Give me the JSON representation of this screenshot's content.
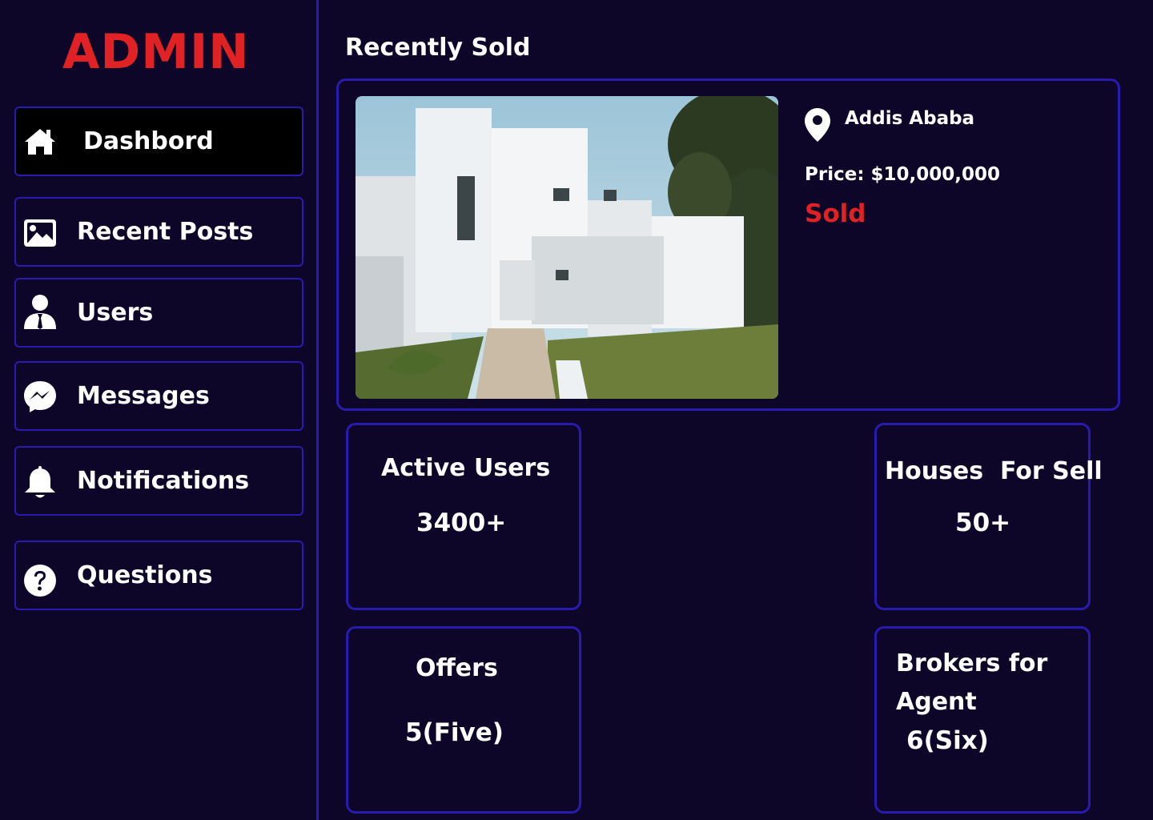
{
  "sidebar": {
    "logo": "ADMIN",
    "items": [
      {
        "label": "Dashbord",
        "icon": "home-icon"
      },
      {
        "label": "Recent Posts",
        "icon": "image-icon"
      },
      {
        "label": "Users",
        "icon": "user-icon"
      },
      {
        "label": "Messages",
        "icon": "messenger-icon"
      },
      {
        "label": "Notifications",
        "icon": "bell-icon"
      },
      {
        "label": "Questions",
        "icon": "question-icon"
      }
    ]
  },
  "main": {
    "title": "Recently Sold",
    "sold": {
      "location": "Addis Ababa",
      "price_label": "Price:",
      "price_value": "$10,000,000",
      "status": "Sold"
    },
    "stats": [
      {
        "title": "Active Users",
        "value": "3400+"
      },
      {
        "title": "Houses  For Sell",
        "value": "50+"
      },
      {
        "title": "Offers",
        "value": "5(Five)"
      },
      {
        "title_line1": "Brokers for",
        "title_line2": "Agent",
        "value": "6(Six)"
      }
    ]
  },
  "colors": {
    "background": "#0d0628",
    "border": "#2a1bb0",
    "accent_red": "#e02224",
    "active_nav": "#000000"
  }
}
